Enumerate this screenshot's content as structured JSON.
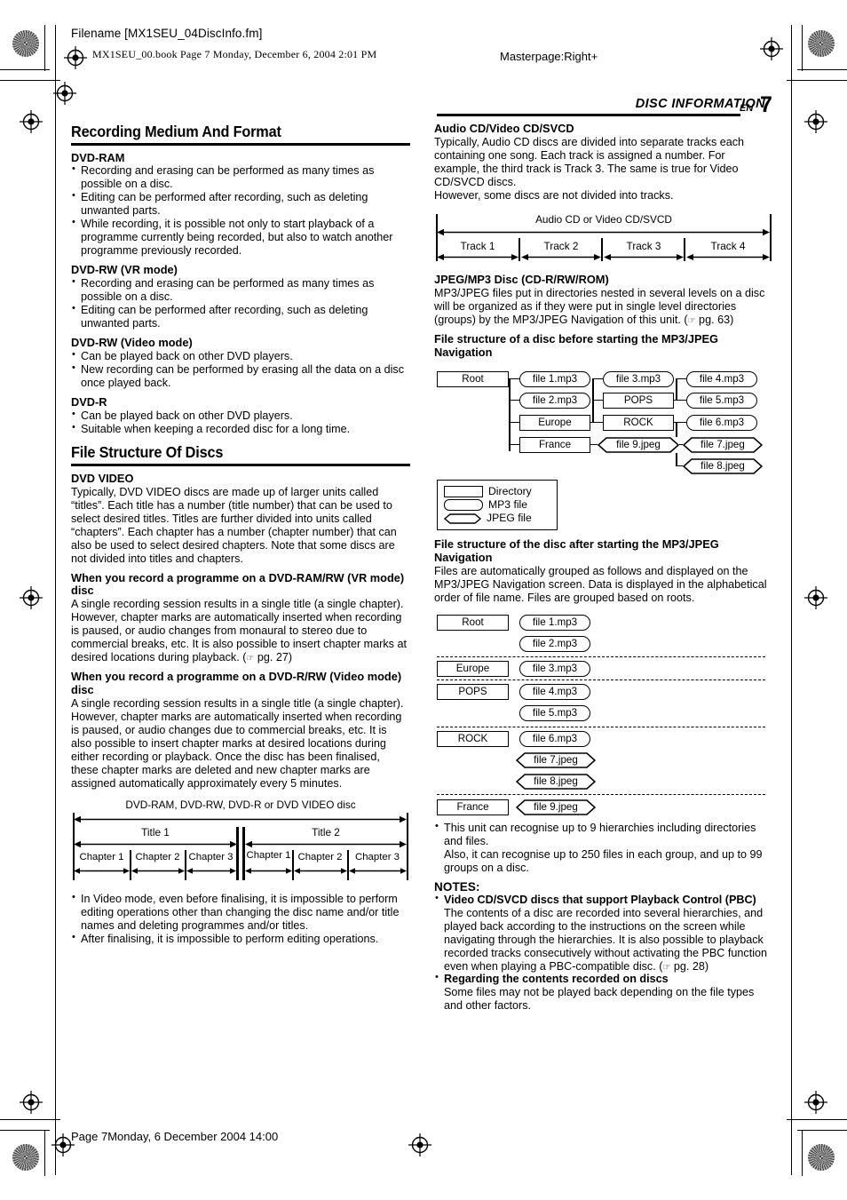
{
  "print_marks": {
    "filename_label": "Filename [MX1SEU_04DiscInfo.fm]",
    "book_line": "MX1SEU_00.book  Page 7  Monday, December 6, 2004  2:01 PM",
    "masterpage": "Masterpage:Right+",
    "footer": "Page 7Monday, 6 December 2004  14:00"
  },
  "running_head": {
    "title": "DISC INFORMATION",
    "lang": "EN",
    "page_number": "7"
  },
  "left_column": {
    "section1": {
      "heading": "Recording Medium And Format",
      "groups": [
        {
          "title": "DVD-RAM",
          "bullets": [
            "Recording and erasing can be performed as many times as possible on a disc.",
            "Editing can be performed after recording, such as deleting unwanted parts.",
            "While recording, it is possible not only to start playback of a programme currently being recorded, but also to watch another programme previously recorded."
          ]
        },
        {
          "title": "DVD-RW (VR mode)",
          "bullets": [
            "Recording and erasing can be performed as many times as possible on a disc.",
            "Editing can be performed after recording, such as deleting unwanted parts."
          ]
        },
        {
          "title": "DVD-RW (Video mode)",
          "bullets": [
            "Can be played back on other DVD players.",
            "New recording can be performed by erasing all the data on a disc once played back."
          ]
        },
        {
          "title": "DVD-R",
          "bullets": [
            "Can be played back on other DVD players.",
            "Suitable when keeping a recorded disc for a long time."
          ]
        }
      ]
    },
    "section2": {
      "heading": "File Structure Of Discs",
      "dvd_video_title": "DVD VIDEO",
      "dvd_video_body": "Typically, DVD VIDEO discs are made up of larger units called “titles”. Each title has a number (title number) that can be used to select desired titles. Titles are further divided into units called “chapters”. Each chapter has a number (chapter number) that can also be used to select desired chapters. Note that some discs are not divided into titles and chapters.",
      "vr_title": "When you record a programme on a DVD-RAM/RW (VR mode) disc",
      "vr_body": "A single recording session results in a single title (a single chapter). However, chapter marks are automatically inserted when recording is paused, or audio changes from monaural to stereo due to commercial breaks, etc. It is also possible to insert chapter marks at desired locations during playback. (",
      "vr_body_ref": " pg. 27)",
      "video_title": "When you record a programme on a DVD-R/RW (Video mode) disc",
      "video_body": "A single recording session results in a single title (a single chapter). However, chapter marks are automatically inserted when recording is paused, or audio changes due to commercial breaks, etc. It is also possible to insert chapter marks at desired locations during either recording or playback. Once the disc has been finalised, these chapter marks are deleted and new chapter marks are assigned automatically approximately every 5 minutes.",
      "diagram": {
        "caption": "DVD-RAM, DVD-RW, DVD-R or DVD VIDEO disc",
        "titles": [
          "Title 1",
          "Title 2"
        ],
        "chapters_t1": [
          "Chapter 1",
          "Chapter 2",
          "Chapter 3"
        ],
        "chapters_t2": [
          "Chapter 1",
          "Chapter 2",
          "Chapter 3"
        ]
      },
      "after_bullets": [
        "In Video mode, even before finalising, it is impossible to perform editing operations other than changing the disc name and/or title names and deleting programmes and/or titles.",
        "After finalising, it is impossible to perform editing operations."
      ]
    }
  },
  "right_column": {
    "audio_cd": {
      "title": "Audio CD/Video CD/SVCD",
      "body": "Typically, Audio CD discs are divided into separate tracks each containing one song. Each track is assigned a number. For example, the third track is Track 3. The same is true for Video CD/SVCD discs.",
      "body2": "However, some discs are not divided into tracks.",
      "diagram": {
        "caption": "Audio CD or Video CD/SVCD",
        "tracks": [
          "Track 1",
          "Track 2",
          "Track 3",
          "Track 4"
        ]
      }
    },
    "jpeg_mp3": {
      "title": "JPEG/MP3 Disc (CD-R/RW/ROM)",
      "body": "MP3/JPEG files put in directories nested in several levels on a disc will be organized as if they were put in single level directories (groups) by the MP3/JPEG Navigation of this unit. (",
      "body_ref": " pg. 63)",
      "before_heading": "File structure of a disc before starting the MP3/JPEG Navigation",
      "tree_before": {
        "root": "Root",
        "nodes": [
          {
            "label": "Root",
            "kind": "dir"
          },
          {
            "label": "file 1.mp3",
            "kind": "mp3"
          },
          {
            "label": "file 2.mp3",
            "kind": "mp3"
          },
          {
            "label": "Europe",
            "kind": "dir"
          },
          {
            "label": "France",
            "kind": "dir"
          },
          {
            "label": "file 3.mp3",
            "kind": "mp3"
          },
          {
            "label": "POPS",
            "kind": "dir"
          },
          {
            "label": "ROCK",
            "kind": "dir"
          },
          {
            "label": "file 9.jpeg",
            "kind": "jpeg"
          },
          {
            "label": "file 4.mp3",
            "kind": "mp3"
          },
          {
            "label": "file 5.mp3",
            "kind": "mp3"
          },
          {
            "label": "file 6.mp3",
            "kind": "mp3"
          },
          {
            "label": "file 7.jpeg",
            "kind": "jpeg"
          },
          {
            "label": "file 8.jpeg",
            "kind": "jpeg"
          }
        ]
      },
      "legend": {
        "directory": "Directory",
        "mp3": "MP3 file",
        "jpeg": "JPEG file"
      },
      "after_heading": "File structure of the disc after starting the MP3/JPEG Navigation",
      "after_body": "Files are automatically grouped as follows and displayed on the MP3/JPEG Navigation screen. Data is displayed in the alphabetical order of file name. Files are grouped based on roots.",
      "tree_after": {
        "groups": [
          {
            "dir": "Root",
            "files": [
              {
                "label": "file 1.mp3",
                "kind": "mp3"
              },
              {
                "label": "file 2.mp3",
                "kind": "mp3"
              }
            ]
          },
          {
            "dir": "Europe",
            "files": [
              {
                "label": "file 3.mp3",
                "kind": "mp3"
              }
            ]
          },
          {
            "dir": "POPS",
            "files": [
              {
                "label": "file 4.mp3",
                "kind": "mp3"
              },
              {
                "label": "file 5.mp3",
                "kind": "mp3"
              }
            ]
          },
          {
            "dir": "ROCK",
            "files": [
              {
                "label": "file 6.mp3",
                "kind": "mp3"
              },
              {
                "label": "file 7.jpeg",
                "kind": "jpeg"
              },
              {
                "label": "file 8.jpeg",
                "kind": "jpeg"
              }
            ]
          },
          {
            "dir": "France",
            "files": [
              {
                "label": "file 9.jpeg",
                "kind": "jpeg"
              }
            ]
          }
        ]
      },
      "hierarchy_bullet_a": "This unit can recognise up to 9 hierarchies including directories and files.",
      "hierarchy_bullet_b": "Also, it can recognise up to 250 files in each group, and up to 99 groups on a disc."
    },
    "notes": {
      "heading": "NOTES:",
      "items": [
        {
          "bold": "Video CD/SVCD discs that support Playback Control (PBC)",
          "text": "The contents of a disc are recorded into several hierarchies, and played back according to the instructions on the screen while navigating through the hierarchies. It is also possible to playback recorded tracks consecutively without activating the PBC function even when playing a PBC-compatible disc. (",
          "ref": " pg. 28)"
        },
        {
          "bold": "Regarding the contents recorded on discs",
          "text": "Some files may not be played back depending on the file types and other factors.",
          "ref": ""
        }
      ]
    }
  },
  "icons": {
    "pointer": "☞"
  }
}
